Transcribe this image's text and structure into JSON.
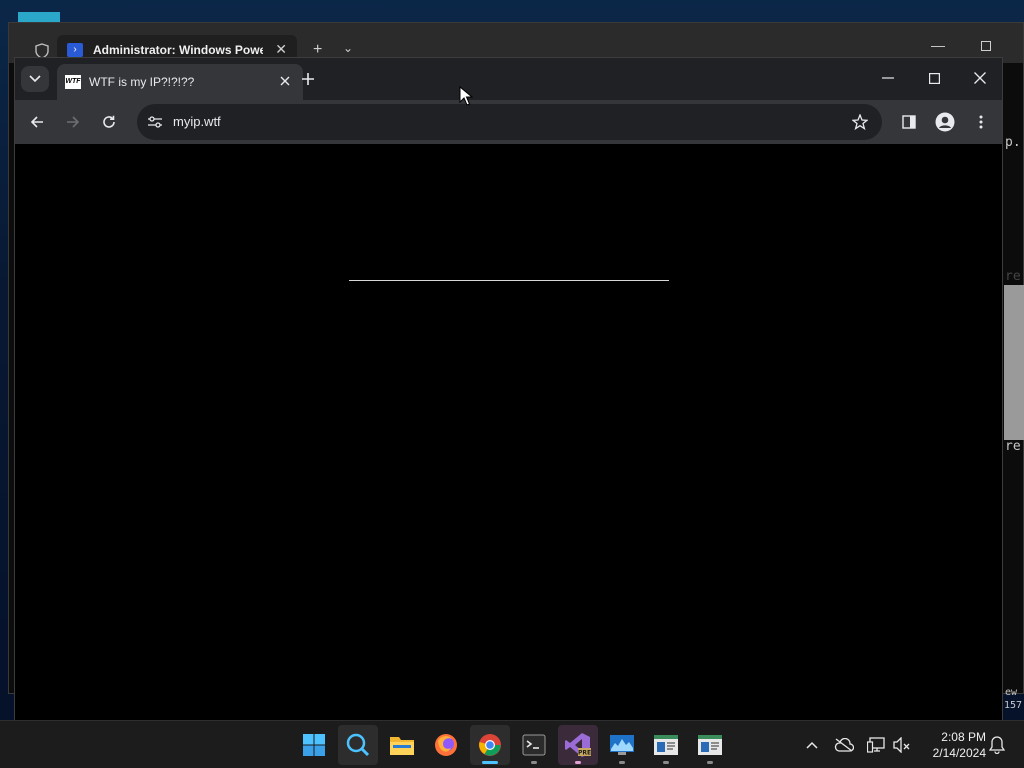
{
  "terminal": {
    "tab_title": "Administrator: Windows Powe",
    "right_fragments": [
      "p.",
      "re",
      "re",
      "ew",
      "157"
    ]
  },
  "browser": {
    "tab_title": "WTF is my IP?!?!??",
    "favicon_text": "WTF",
    "url": "myip.wtf"
  },
  "taskbar": {
    "apps": [
      {
        "name": "start",
        "icon": "windows-logo-icon"
      },
      {
        "name": "search",
        "icon": "search-icon"
      },
      {
        "name": "file-explorer",
        "icon": "folder-icon"
      },
      {
        "name": "firefox",
        "icon": "firefox-icon"
      },
      {
        "name": "chrome",
        "icon": "chrome-icon"
      },
      {
        "name": "terminal",
        "icon": "terminal-icon"
      },
      {
        "name": "visual-studio-preview",
        "icon": "visual-studio-icon",
        "badge": "PRE"
      },
      {
        "name": "resource-monitor",
        "icon": "monitor-chart-icon"
      },
      {
        "name": "window-app-1",
        "icon": "app-window-icon"
      },
      {
        "name": "window-app-2",
        "icon": "app-window-icon"
      }
    ],
    "clock_time": "2:08 PM",
    "clock_date": "2/14/2024"
  },
  "colors": {
    "chrome_dark": "#202124",
    "chrome_toolbar": "#35363a",
    "taskbar": "#1c1c1c",
    "accent": "#4cc2ff"
  }
}
